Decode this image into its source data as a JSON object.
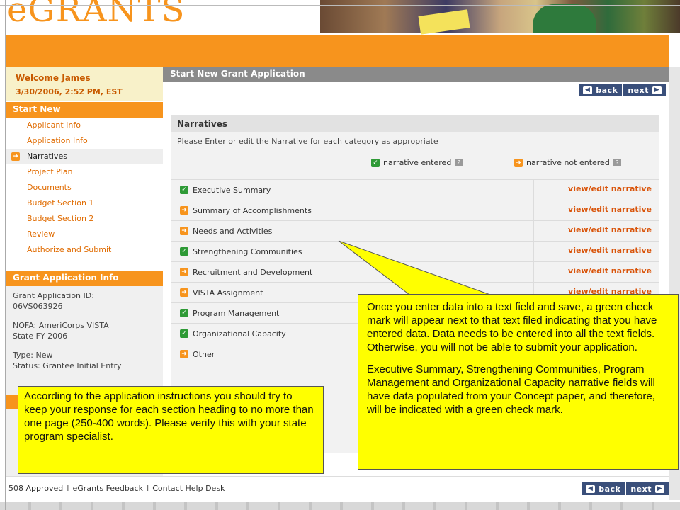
{
  "header": {
    "logo_text": "eGRANTS"
  },
  "sidebar": {
    "welcome": "Welcome James",
    "datetime": "3/30/2006, 2:52 PM, EST",
    "start_new_heading": "Start New",
    "nav_items": [
      {
        "label": "Applicant Info",
        "active": false
      },
      {
        "label": "Application Info",
        "active": false
      },
      {
        "label": "Narratives",
        "active": true
      },
      {
        "label": "Project Plan",
        "active": false
      },
      {
        "label": "Documents",
        "active": false
      },
      {
        "label": "Budget Section 1",
        "active": false
      },
      {
        "label": "Budget Section 2",
        "active": false
      },
      {
        "label": "Review",
        "active": false
      },
      {
        "label": "Authorize and Submit",
        "active": false
      }
    ],
    "grant_info_heading": "Grant Application Info",
    "grant_info": {
      "id_label": "Grant Application ID:",
      "id_value": "06VS063926",
      "nofa_label": "NOFA: AmeriCorps VISTA",
      "nofa_value": "State FY 2006",
      "type": "Type: New",
      "status": "Status: Grantee Initial Entry"
    }
  },
  "main": {
    "heading": "Start New Grant Application",
    "back_label": "back",
    "next_label": "next",
    "narratives": {
      "heading": "Narratives",
      "instructions": "Please Enter or edit the Narrative for each category as appropriate",
      "legend_entered": "narrative entered",
      "legend_not_entered": "narrative not entered",
      "link_label": "view/edit narrative",
      "rows": [
        {
          "label": "Executive Summary",
          "entered": true
        },
        {
          "label": "Summary of Accomplishments",
          "entered": false
        },
        {
          "label": "Needs and Activities",
          "entered": false
        },
        {
          "label": "Strengthening Communities",
          "entered": true
        },
        {
          "label": "Recruitment and Development",
          "entered": false
        },
        {
          "label": "VISTA Assignment",
          "entered": false
        },
        {
          "label": "Program Management",
          "entered": true
        },
        {
          "label": "Organizational Capacity",
          "entered": true
        },
        {
          "label": "Other",
          "entered": false
        }
      ]
    }
  },
  "footer": {
    "links": [
      "508 Approved",
      "eGrants Feedback",
      "Contact Help Desk"
    ],
    "divider": "I"
  },
  "callouts": {
    "right_p1": "Once you enter data into a text field and save, a green check mark will appear next to that text filed indicating that you have entered data.  Data needs to be entered into all the text fields.  Otherwise, you will not be able to submit your application.",
    "right_p2": "Executive Summary, Strengthening Communities, Program Management and Organizational Capacity narrative fields will have data populated from your Concept paper, and therefore, will be indicated with a green check mark.",
    "left": "According to the application instructions you should try to keep your response for each section heading to no more than one page (250-400 words).  Please verify this with your state program specialist."
  },
  "colors": {
    "brand_orange": "#f7941d",
    "link_orange": "#d9540a",
    "button_navy": "#3a4f7a",
    "check_green": "#2e9a36",
    "callout_yellow": "#ffff00"
  },
  "icons": {
    "entered": "check-icon",
    "not_entered": "arrow-right-icon",
    "help": "help-icon"
  }
}
